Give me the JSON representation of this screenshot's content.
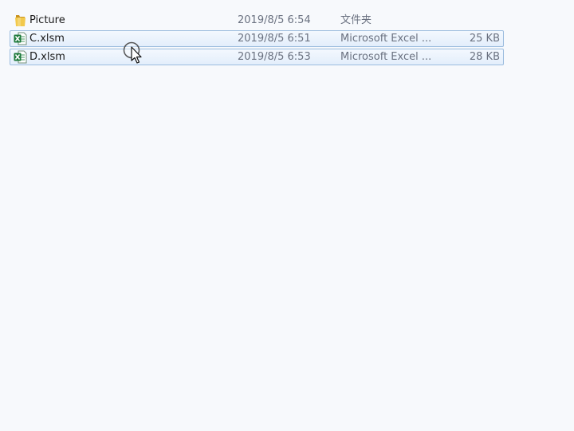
{
  "file_list": {
    "rows": [
      {
        "name": "Picture",
        "date_modified": "2019/8/5 6:54",
        "type": "文件夹",
        "size": "",
        "icon": "folder-icon",
        "selected": false
      },
      {
        "name": "C.xlsm",
        "date_modified": "2019/8/5 6:51",
        "type": "Microsoft Excel ...",
        "size": "25 KB",
        "icon": "excel-file-icon",
        "selected": true
      },
      {
        "name": "D.xlsm",
        "date_modified": "2019/8/5 6:53",
        "type": "Microsoft Excel ...",
        "size": "28 KB",
        "icon": "excel-file-icon",
        "selected": true
      }
    ]
  },
  "colors": {
    "selection_border": "#9bbcde",
    "selection_fill": "#e3eefb",
    "folder": "#e8b83a",
    "excel_green": "#1e7a3c"
  },
  "cursor": {
    "icon": "busy-pointer-icon"
  }
}
